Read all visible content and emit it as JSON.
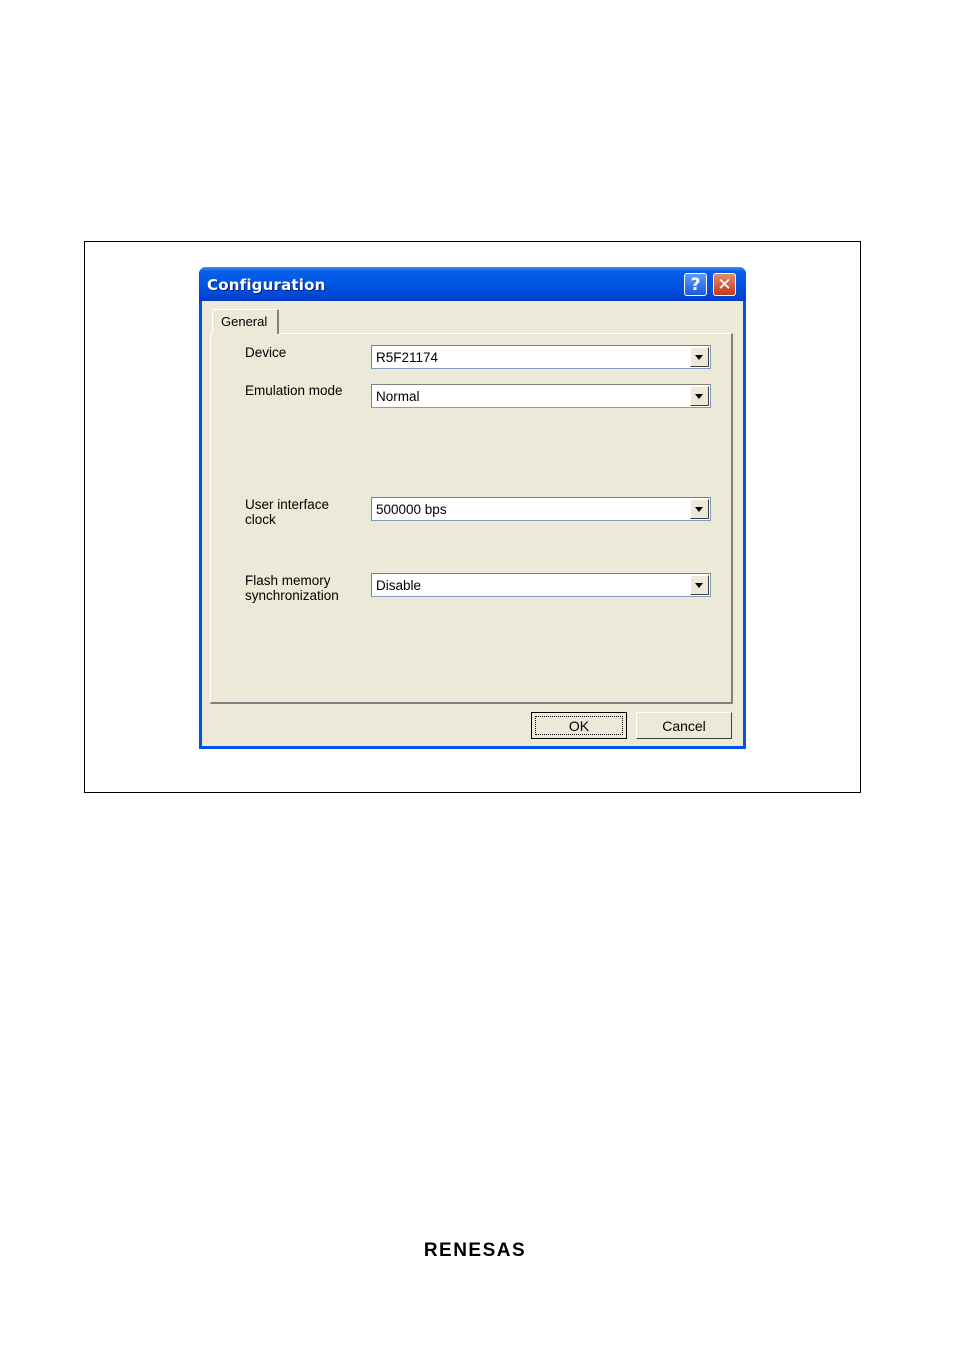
{
  "dialog": {
    "title": "Configuration",
    "help_icon": "question-mark-icon",
    "close_icon": "close-x-icon",
    "help_glyph": "?",
    "close_glyph": "✕"
  },
  "tabs": [
    {
      "label": "General",
      "selected": true
    }
  ],
  "fields": {
    "device": {
      "label": "Device",
      "value": "R5F21174"
    },
    "emulation_mode": {
      "label": "Emulation mode",
      "value": "Normal"
    },
    "user_interface_clock": {
      "label_line1": "User interface",
      "label_line2": "clock",
      "value": "500000 bps"
    },
    "flash_memory_sync": {
      "label_line1": "Flash memory",
      "label_line2": "synchronization",
      "value": "Disable"
    }
  },
  "buttons": {
    "ok": "OK",
    "cancel": "Cancel"
  },
  "logo": {
    "text": "RENESAS"
  },
  "colors": {
    "title_bar": "#0054e3",
    "dialog_face": "#ece9d8",
    "close_button": "#c4381a"
  }
}
